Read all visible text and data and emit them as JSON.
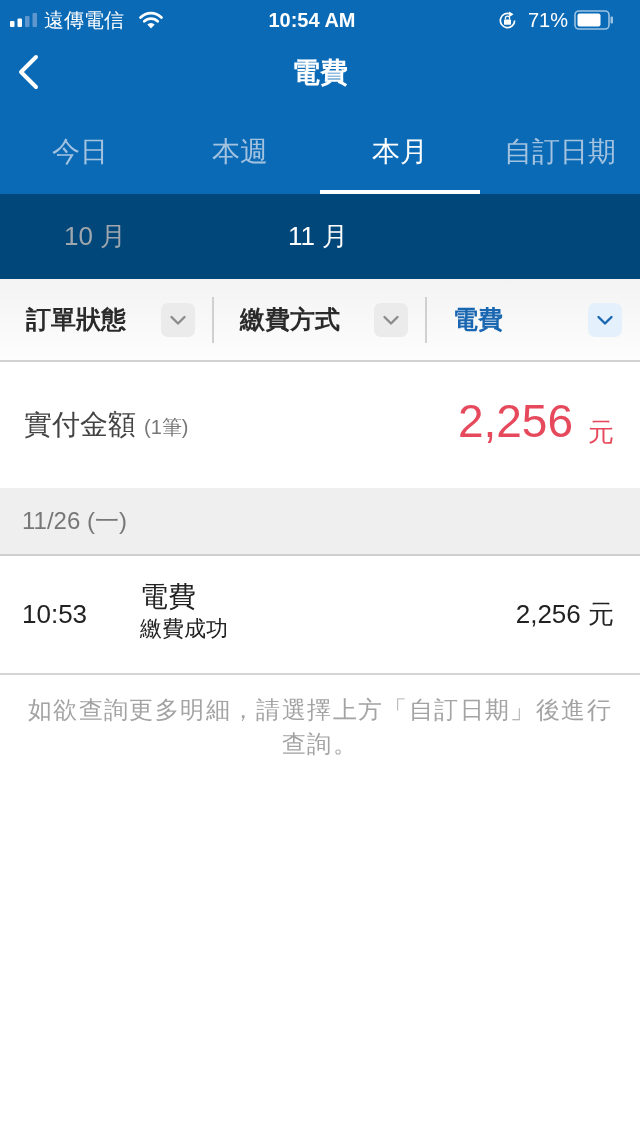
{
  "status_bar": {
    "carrier": "遠傳電信",
    "time": "10:54 AM",
    "battery": "71%"
  },
  "nav": {
    "title": "電費"
  },
  "tabs": [
    {
      "label": "今日",
      "selected": false
    },
    {
      "label": "本週",
      "selected": false
    },
    {
      "label": "本月",
      "selected": true
    },
    {
      "label": "自訂日期",
      "selected": false
    }
  ],
  "months": [
    {
      "label": "10 月",
      "selected": false
    },
    {
      "label": "11 月",
      "selected": true
    }
  ],
  "filters": [
    {
      "label": "訂單狀態",
      "selected": false
    },
    {
      "label": "繳費方式",
      "selected": false
    },
    {
      "label": "電費",
      "selected": true
    }
  ],
  "summary": {
    "label": "實付金額",
    "count": "(1筆)",
    "amount": "2,256",
    "unit": "元"
  },
  "groups": [
    {
      "date": "11/26 (一)",
      "transactions": [
        {
          "time": "10:53",
          "title": "電費",
          "status": "繳費成功",
          "amount": "2,256 元"
        }
      ]
    }
  ],
  "note": "如欲查詢更多明細，請選擇上方「自訂日期」後進行查詢。"
}
